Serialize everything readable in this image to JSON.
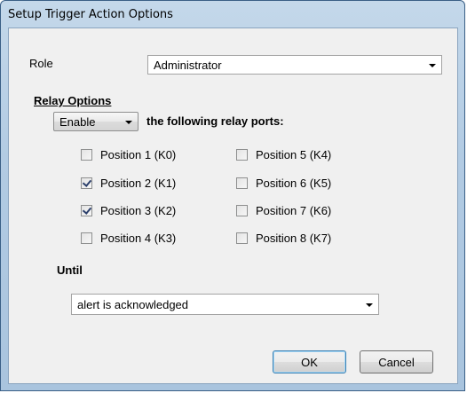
{
  "window": {
    "title": "Setup Trigger Action Options"
  },
  "role": {
    "label": "Role",
    "selected": "Administrator"
  },
  "relay": {
    "section_label": "Relay Options",
    "mode_selected": "Enable",
    "suffix_text": "the following relay ports:",
    "positions": [
      {
        "label": "Position 1 (K0)",
        "checked": false
      },
      {
        "label": "Position 2 (K1)",
        "checked": true
      },
      {
        "label": "Position 3 (K2)",
        "checked": true
      },
      {
        "label": "Position 4 (K3)",
        "checked": false
      },
      {
        "label": "Position 5 (K4)",
        "checked": false
      },
      {
        "label": "Position 6 (K5)",
        "checked": false
      },
      {
        "label": "Position 7 (K6)",
        "checked": false
      },
      {
        "label": "Position 8 (K7)",
        "checked": false
      }
    ]
  },
  "until": {
    "label": "Until",
    "selected": "alert is acknowledged"
  },
  "buttons": {
    "ok": "OK",
    "cancel": "Cancel"
  }
}
